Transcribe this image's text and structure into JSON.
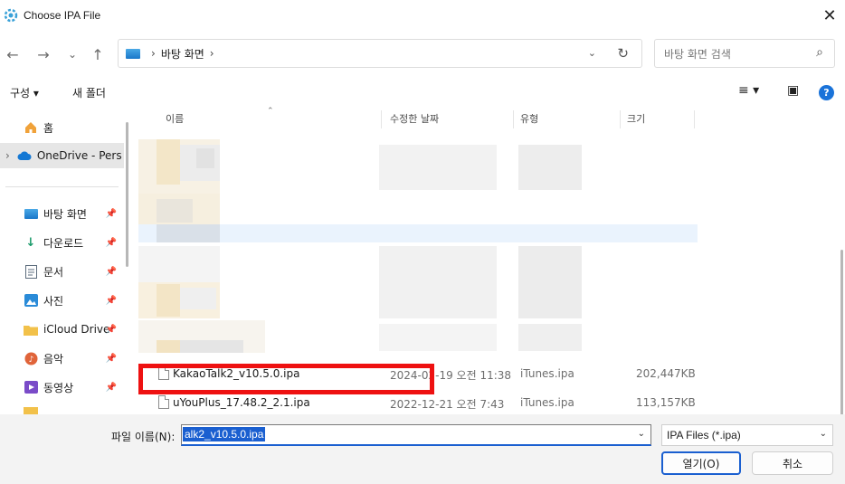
{
  "window": {
    "title": "Choose IPA File",
    "close_glyph": "✕"
  },
  "nav": {
    "back_glyph": "←",
    "forward_glyph": "→",
    "recent_glyph": "⌄",
    "up_glyph": "↑",
    "breadcrumb_sep": "›",
    "breadcrumb": [
      "바탕 화면"
    ],
    "dropdown_glyph": "⌄",
    "refresh_glyph": "↻",
    "search_placeholder": "바탕 화면 검색",
    "search_glyph": "⌕"
  },
  "toolbar": {
    "organize": "구성 ▾",
    "new_folder": "새 폴더",
    "view_glyph": "≡ ▾",
    "pane_glyph": "▣",
    "help_glyph": "?"
  },
  "sidebar": {
    "home": "홈",
    "onedrive": "OneDrive - Pers",
    "expand_glyph": "›",
    "pin_glyph": "📌",
    "items": [
      {
        "label": "바탕 화면",
        "icon": "desktop-icon"
      },
      {
        "label": "다운로드",
        "icon": "download-icon"
      },
      {
        "label": "문서",
        "icon": "document-icon"
      },
      {
        "label": "사진",
        "icon": "picture-icon"
      },
      {
        "label": "iCloud Drive",
        "icon": "folder-icon"
      },
      {
        "label": "음악",
        "icon": "music-icon"
      },
      {
        "label": "동영상",
        "icon": "video-icon"
      }
    ]
  },
  "columns": {
    "name": "이름",
    "date": "수정한 날짜",
    "type": "유형",
    "size": "크기",
    "sort_glyph": "⌃"
  },
  "files": [
    {
      "name": "KakaoTalk2_v10.5.0.ipa",
      "date": "2024-02-19 오전 11:38",
      "type": "iTunes.ipa",
      "size": "202,447KB"
    },
    {
      "name": "uYouPlus_17.48.2_2.1.ipa",
      "date": "2022-12-21 오전 7:43",
      "type": "iTunes.ipa",
      "size": "113,157KB"
    }
  ],
  "footer": {
    "filename_label": "파일 이름(N):",
    "filename_value": "alk2_v10.5.0.ipa",
    "filter": "IPA Files (*.ipa)",
    "dropdown_glyph": "⌄",
    "open_button": "열기(O)",
    "cancel_button": "취소"
  },
  "colors": {
    "highlight": "#ee1111",
    "accent": "#1a5fd0"
  }
}
